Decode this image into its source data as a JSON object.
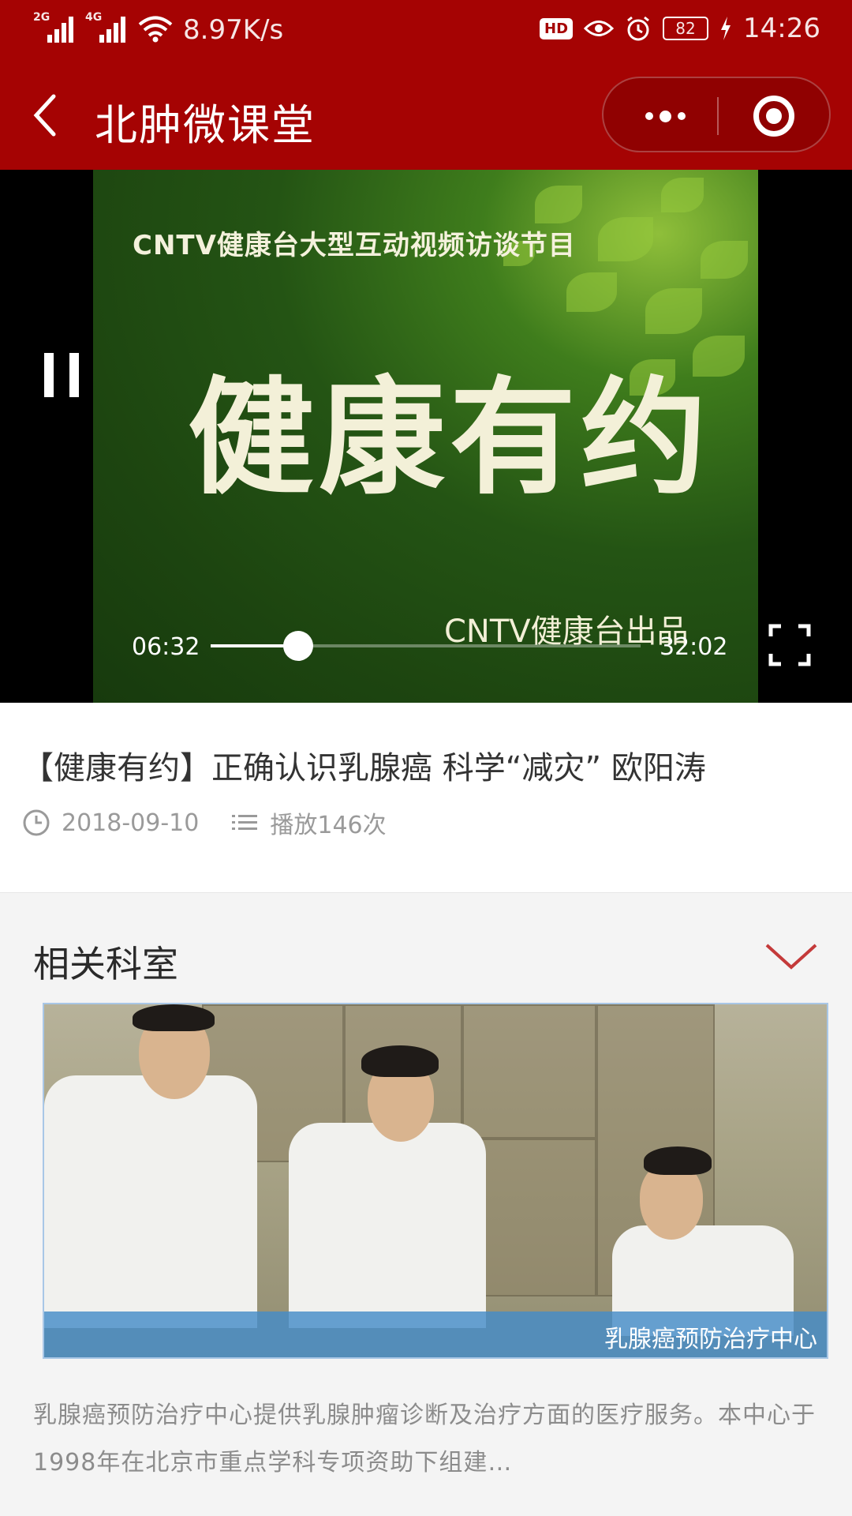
{
  "status_bar": {
    "signal1": "2G",
    "signal2": "4G",
    "speed": "8.97K/s",
    "hd": "HD",
    "battery": "82",
    "time": "14:26"
  },
  "nav": {
    "title": "北肿微课堂",
    "accent": "#a50303"
  },
  "video": {
    "overlay_subtitle": "CNTV健康台大型互动视频访谈节目",
    "overlay_title": "健康有约",
    "overlay_credit": "CNTV健康台出品",
    "current_time": "06:32",
    "duration": "32:02",
    "progress": 0.204
  },
  "info": {
    "title": "【健康有约】正确认识乳腺癌 科学“减灾” 欧阳涛",
    "date": "2018-09-10",
    "plays": "播放146次"
  },
  "related": {
    "heading": "相关科室",
    "card_label": "乳腺癌预防治疗中心",
    "description": "乳腺癌预防治疗中心提供乳腺肿瘤诊断及治疗方面的医疗服务。本中心于1998年在北京市重点学科专项资助下组建…"
  }
}
